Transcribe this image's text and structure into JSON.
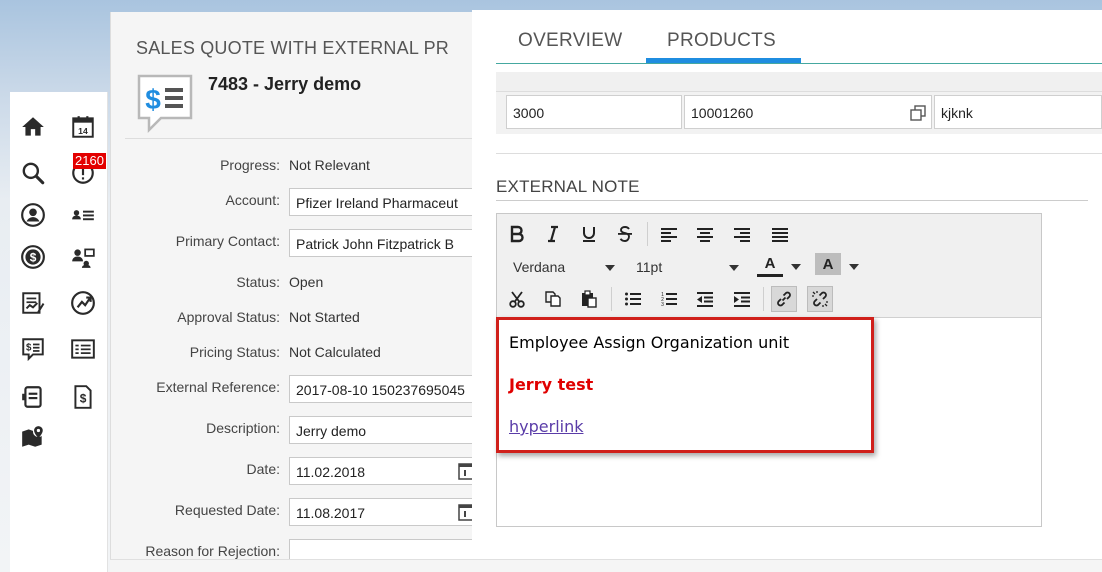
{
  "document": {
    "title": "SALES QUOTE WITH EXTERNAL PR",
    "id_line": "7483 - Jerry demo"
  },
  "nav": {
    "notification_count": "2160",
    "icons": [
      "home-icon",
      "calendar-icon",
      "search-icon",
      "alert-icon",
      "user-icon",
      "contacts-icon",
      "dollar-icon",
      "team-icon",
      "report-icon",
      "growth-icon",
      "quote-icon",
      "list-icon",
      "device-icon",
      "invoice-icon",
      "map-icon"
    ],
    "calendar_day": "14"
  },
  "fields": {
    "progress": {
      "label": "Progress:",
      "value": "Not Relevant"
    },
    "account": {
      "label": "Account:",
      "value": "Pfizer Ireland Pharmaceut"
    },
    "primary_contact": {
      "label": "Primary Contact:",
      "value": "Patrick John Fitzpatrick B"
    },
    "status": {
      "label": "Status:",
      "value": "Open"
    },
    "approval_status": {
      "label": "Approval Status:",
      "value": "Not Started"
    },
    "pricing_status": {
      "label": "Pricing Status:",
      "value": "Not Calculated"
    },
    "external_reference": {
      "label": "External Reference:",
      "value": "2017-08-10 150237695045"
    },
    "description": {
      "label": "Description:",
      "value": "Jerry demo"
    },
    "date": {
      "label": "Date:",
      "value": "11.02.2018"
    },
    "requested_date": {
      "label": "Requested Date:",
      "value": "11.08.2017"
    },
    "reason_for_rejection": {
      "label": "Reason for Rejection:",
      "value": ""
    }
  },
  "tabs": {
    "overview": "OVERVIEW",
    "products": "PRODUCTS",
    "active": "products"
  },
  "product_row": {
    "cell1": "3000",
    "cell2": "10001260",
    "cell3": "kjknk"
  },
  "external_note": {
    "title": "EXTERNAL NOTE",
    "font_family": "Verdana",
    "font_size": "11pt",
    "text_color_label": "A",
    "highlight_label": "A",
    "content": {
      "line1": "Employee Assign Organization unit",
      "line2": "Jerry test",
      "line3": "hyperlink"
    }
  },
  "colors": {
    "accent": "#1f8de0",
    "highlight_border": "#d0201b",
    "bold_red": "#e00000",
    "link": "#5a3ca8",
    "badge": "#e30000",
    "icon": "#2a2a2a"
  }
}
